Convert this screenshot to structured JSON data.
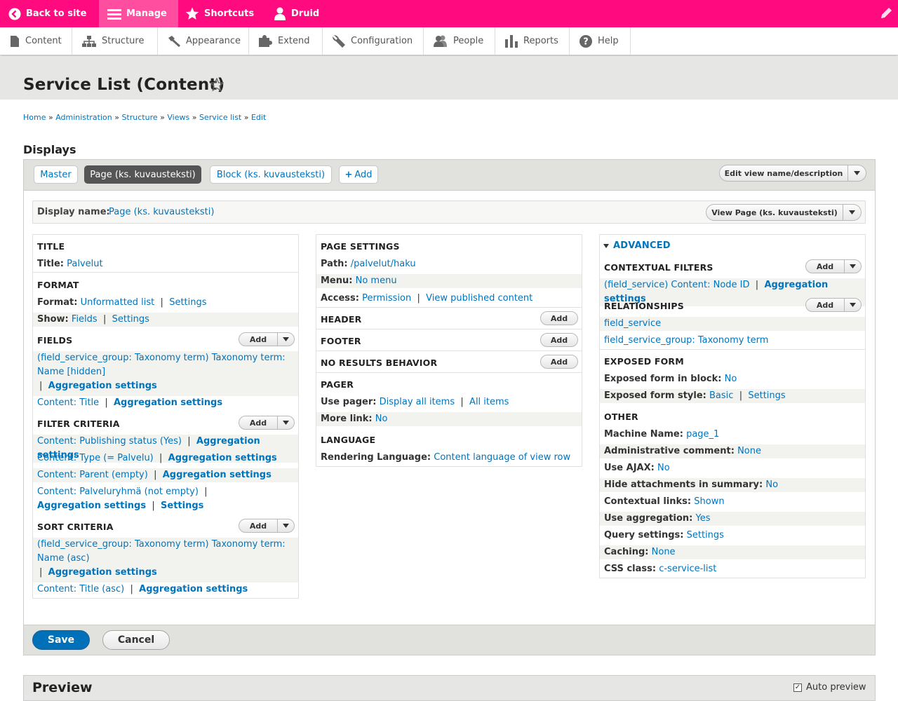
{
  "toolbar": {
    "back": "Back to site",
    "manage": "Manage",
    "shortcuts": "Shortcuts",
    "user": "Druid"
  },
  "admin_menu": [
    "Content",
    "Structure",
    "Appearance",
    "Extend",
    "Configuration",
    "People",
    "Reports",
    "Help"
  ],
  "page_title": "Service List (Content)",
  "breadcrumb": [
    "Home",
    "Administration",
    "Structure",
    "Views",
    "Service list",
    "Edit"
  ],
  "breadcrumb_sep": "»",
  "displays_heading": "Displays",
  "tabs": {
    "master": "Master",
    "page": "Page (ks. kuvausteksti)",
    "block": "Block (ks. kuvausteksti)",
    "add": "Add",
    "edit_view": "Edit view name/description"
  },
  "display_name": {
    "label": "Display name:",
    "value": "Page (ks. kuvausteksti)",
    "view_button": "View Page (ks. kuvausteksti)"
  },
  "common": {
    "add": "Add",
    "sep": "|",
    "aggregation": "Aggregation settings",
    "settings": "Settings"
  },
  "col1": {
    "title_h": "TITLE",
    "title_label": "Title:",
    "title_value": "Palvelut",
    "format_h": "FORMAT",
    "format_label": "Format:",
    "format_value": "Unformatted list",
    "show_label": "Show:",
    "show_value": "Fields",
    "fields_h": "FIELDS",
    "field1_a": "(field_service_group: Taxonomy term) Taxonomy term:",
    "field1_b": "Name [hidden]",
    "field2": "Content: Title",
    "filter_h": "FILTER CRITERIA",
    "filter1": "Content: Publishing status (Yes)",
    "filter2": "Content: Type (= Palvelu)",
    "filter3": "Content: Parent (empty)",
    "filter4": "Content: Palveluryhmä (not empty)",
    "sort_h": "SORT CRITERIA",
    "sort1_a": "(field_service_group: Taxonomy term) Taxonomy term:",
    "sort1_b": "Name (asc)",
    "sort2": "Content: Title (asc)"
  },
  "col2": {
    "page_h": "PAGE SETTINGS",
    "path_label": "Path:",
    "path_value": "/palvelut/haku",
    "menu_label": "Menu:",
    "menu_value": "No menu",
    "access_label": "Access:",
    "access_value": "Permission",
    "access_extra": "View published content",
    "header_h": "HEADER",
    "footer_h": "FOOTER",
    "noresults_h": "NO RESULTS BEHAVIOR",
    "pager_h": "PAGER",
    "usepager_label": "Use pager:",
    "usepager_value": "Display all items",
    "usepager_extra": "All items",
    "more_label": "More link:",
    "more_value": "No",
    "lang_h": "LANGUAGE",
    "render_label": "Rendering Language:",
    "render_value": "Content language of view row"
  },
  "col3": {
    "advanced": "ADVANCED",
    "ctx_h": "CONTEXTUAL FILTERS",
    "ctx1": "(field_service) Content: Node ID",
    "rel_h": "RELATIONSHIPS",
    "rel1": "field_service",
    "rel2": "field_service_group: Taxonomy term",
    "exposed_h": "EXPOSED FORM",
    "exp_block_label": "Exposed form in block:",
    "exp_block_value": "No",
    "exp_style_label": "Exposed form style:",
    "exp_style_value": "Basic",
    "other_h": "OTHER",
    "machine_label": "Machine Name:",
    "machine_value": "page_1",
    "admin_label": "Administrative comment:",
    "admin_value": "None",
    "ajax_label": "Use AJAX:",
    "ajax_value": "No",
    "hide_label": "Hide attachments in summary:",
    "hide_value": "No",
    "ctxlinks_label": "Contextual links:",
    "ctxlinks_value": "Shown",
    "useagg_label": "Use aggregation:",
    "useagg_value": "Yes",
    "query_label": "Query settings:",
    "query_value": "Settings",
    "caching_label": "Caching:",
    "caching_value": "None",
    "css_label": "CSS class:",
    "css_value": "c-service-list"
  },
  "buttons": {
    "save": "Save",
    "cancel": "Cancel"
  },
  "preview": {
    "title": "Preview",
    "auto": "Auto preview",
    "checked": "✓"
  },
  "colors": {
    "toolbar": "#ff0a7f",
    "link": "#0074bd",
    "primary_button": "#0071b8"
  }
}
